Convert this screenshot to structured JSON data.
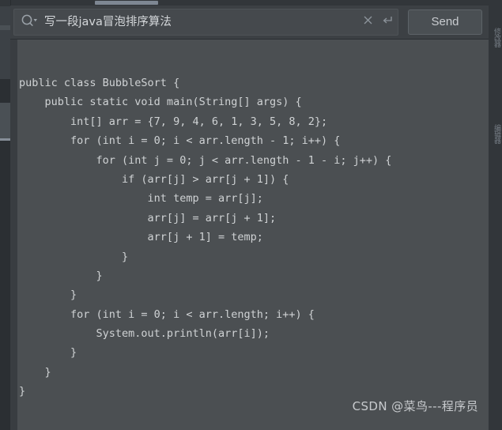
{
  "header": {
    "search": {
      "value": "写一段java冒泡排序算法",
      "placeholder": "",
      "icon": "search-icon",
      "dropdown_icon": "chevron-down-icon"
    },
    "clear_icon": "close-icon",
    "enter_icon": "return-arrow-icon",
    "send_label": "Send"
  },
  "right_rail": {
    "tabs": [
      "修改器",
      "编辑器"
    ]
  },
  "code": {
    "language": "java",
    "lines": [
      "public class BubbleSort {",
      "    public static void main(String[] args) {",
      "        int[] arr = {7, 9, 4, 6, 1, 3, 5, 8, 2};",
      "        for (int i = 0; i < arr.length - 1; i++) {",
      "            for (int j = 0; j < arr.length - 1 - i; j++) {",
      "                if (arr[j] > arr[j + 1]) {",
      "                    int temp = arr[j];",
      "                    arr[j] = arr[j + 1];",
      "                    arr[j + 1] = temp;",
      "                }",
      "            }",
      "        }",
      "        for (int i = 0; i < arr.length; i++) {",
      "            System.out.println(arr[i]);",
      "        }",
      "    }",
      "}"
    ]
  },
  "watermark": {
    "text": "CSDN @菜鸟---程序员"
  },
  "colors": {
    "window_bg": "#32363a",
    "header_bg": "#3c4044",
    "code_bg": "#4b4f52",
    "code_fg": "#cfd2d4",
    "accent": "#7e8793"
  }
}
